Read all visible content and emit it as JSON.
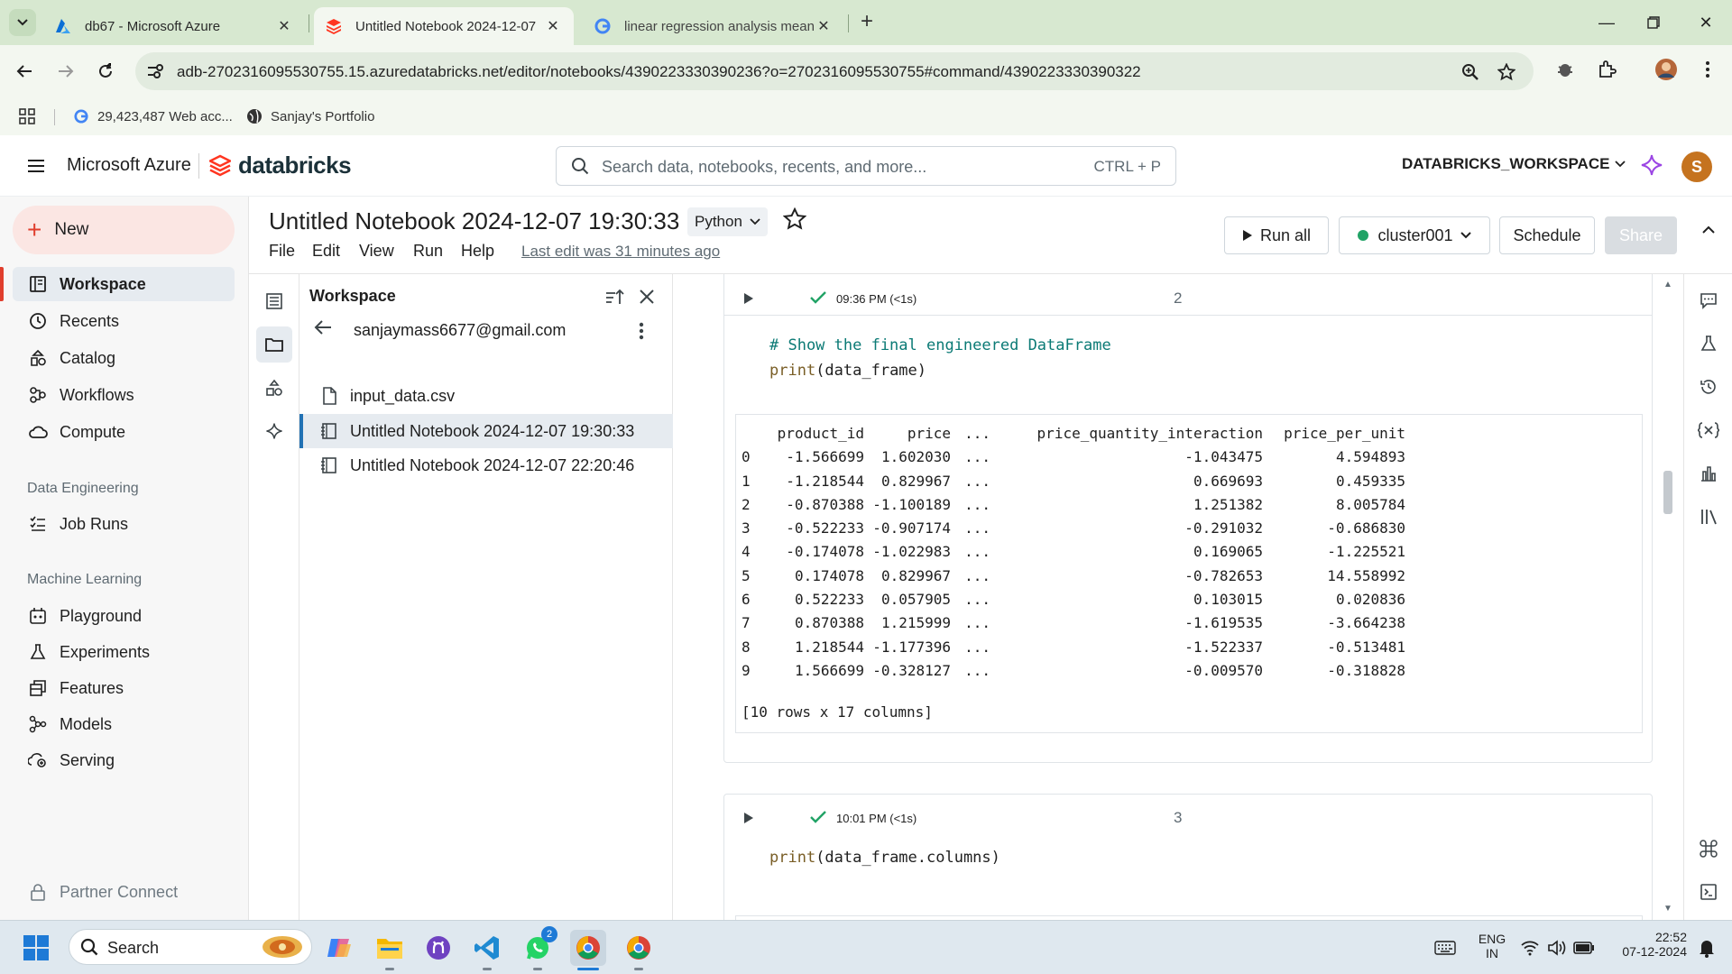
{
  "browser": {
    "tabs": [
      {
        "title": "db67 - Microsoft Azure",
        "active": false
      },
      {
        "title": "Untitled Notebook 2024-12-07",
        "active": true
      },
      {
        "title": "linear regression analysis meani",
        "active": false
      }
    ],
    "url": "adb-2702316095530755.15.azuredatabricks.net/editor/notebooks/4390223330390236?o=2702316095530755#command/4390223330390322",
    "bookmarks": [
      {
        "label": "29,423,487 Web acc...",
        "icon": "google-icon"
      },
      {
        "label": "Sanjay's Portfolio",
        "icon": "globe-icon"
      }
    ]
  },
  "header": {
    "azure_label": "Microsoft Azure",
    "brand": "databricks",
    "search_placeholder": "Search data, notebooks, recents, and more...",
    "search_shortcut": "CTRL + P",
    "workspace": "DATABRICKS_WORKSPACE",
    "avatar_initial": "S"
  },
  "sidebar": {
    "new_label": "New",
    "items": [
      {
        "label": "Workspace",
        "icon": "workspace-icon",
        "selected": true
      },
      {
        "label": "Recents",
        "icon": "clock-icon"
      },
      {
        "label": "Catalog",
        "icon": "catalog-icon"
      },
      {
        "label": "Workflows",
        "icon": "workflows-icon"
      },
      {
        "label": "Compute",
        "icon": "cloud-icon"
      }
    ],
    "sections": [
      {
        "title": "Data Engineering",
        "items": [
          {
            "label": "Job Runs",
            "icon": "job-runs-icon"
          }
        ]
      },
      {
        "title": "Machine Learning",
        "items": [
          {
            "label": "Playground",
            "icon": "playground-icon"
          },
          {
            "label": "Experiments",
            "icon": "flask-icon"
          },
          {
            "label": "Features",
            "icon": "features-icon"
          },
          {
            "label": "Models",
            "icon": "models-icon"
          },
          {
            "label": "Serving",
            "icon": "serving-icon"
          }
        ]
      }
    ],
    "footer": "Partner Connect"
  },
  "notebook": {
    "title": "Untitled Notebook 2024-12-07 19:30:33",
    "language": "Python",
    "menu": [
      "File",
      "Edit",
      "View",
      "Run",
      "Help"
    ],
    "last_edit": "Last edit was 31 minutes ago",
    "run_all": "Run all",
    "cluster": "cluster001",
    "cluster_status_color": "#21a366",
    "schedule": "Schedule",
    "share": "Share"
  },
  "workspace_panel": {
    "title": "Workspace",
    "user": "sanjaymass6677@gmail.com",
    "files": [
      {
        "name": "input_data.csv",
        "icon": "file-icon"
      },
      {
        "name": "Untitled Notebook 2024-12-07 19:30:33",
        "icon": "notebook-icon",
        "selected": true
      },
      {
        "name": "Untitled Notebook 2024-12-07 22:20:46",
        "icon": "notebook-icon"
      }
    ]
  },
  "cells": [
    {
      "time": "09:36 PM (<1s)",
      "number": "2",
      "code_comment": "# Show the final engineered DataFrame",
      "code_fn": "print",
      "code_args": "(data_frame)",
      "output": {
        "columns": [
          "",
          "product_id",
          "price",
          "...",
          "price_quantity_interaction",
          "price_per_unit"
        ],
        "rows": [
          [
            "0",
            "-1.566699",
            "1.602030",
            "...",
            "-1.043475",
            "4.594893"
          ],
          [
            "1",
            "-1.218544",
            "0.829967",
            "...",
            "0.669693",
            "0.459335"
          ],
          [
            "2",
            "-0.870388",
            "-1.100189",
            "...",
            "1.251382",
            "8.005784"
          ],
          [
            "3",
            "-0.522233",
            "-0.907174",
            "...",
            "-0.291032",
            "-0.686830"
          ],
          [
            "4",
            "-0.174078",
            "-1.022983",
            "...",
            "0.169065",
            "-1.225521"
          ],
          [
            "5",
            "0.174078",
            "0.829967",
            "...",
            "-0.782653",
            "14.558992"
          ],
          [
            "6",
            "0.522233",
            "0.057905",
            "...",
            "0.103015",
            "0.020836"
          ],
          [
            "7",
            "0.870388",
            "1.215999",
            "...",
            "-1.619535",
            "-3.664238"
          ],
          [
            "8",
            "1.218544",
            "-1.177396",
            "...",
            "-1.522337",
            "-0.513481"
          ],
          [
            "9",
            "1.566699",
            "-0.328127",
            "...",
            "-0.009570",
            "-0.318828"
          ]
        ],
        "summary": "[10 rows x 17 columns]"
      }
    },
    {
      "time": "10:01 PM (<1s)",
      "number": "3",
      "code_fn": "print",
      "code_args": "(data_frame.columns)"
    }
  ],
  "taskbar": {
    "search_placeholder": "Search",
    "whatsapp_badge": "2",
    "lang_line1": "ENG",
    "lang_line2": "IN",
    "time": "22:52",
    "date": "07-12-2024"
  }
}
